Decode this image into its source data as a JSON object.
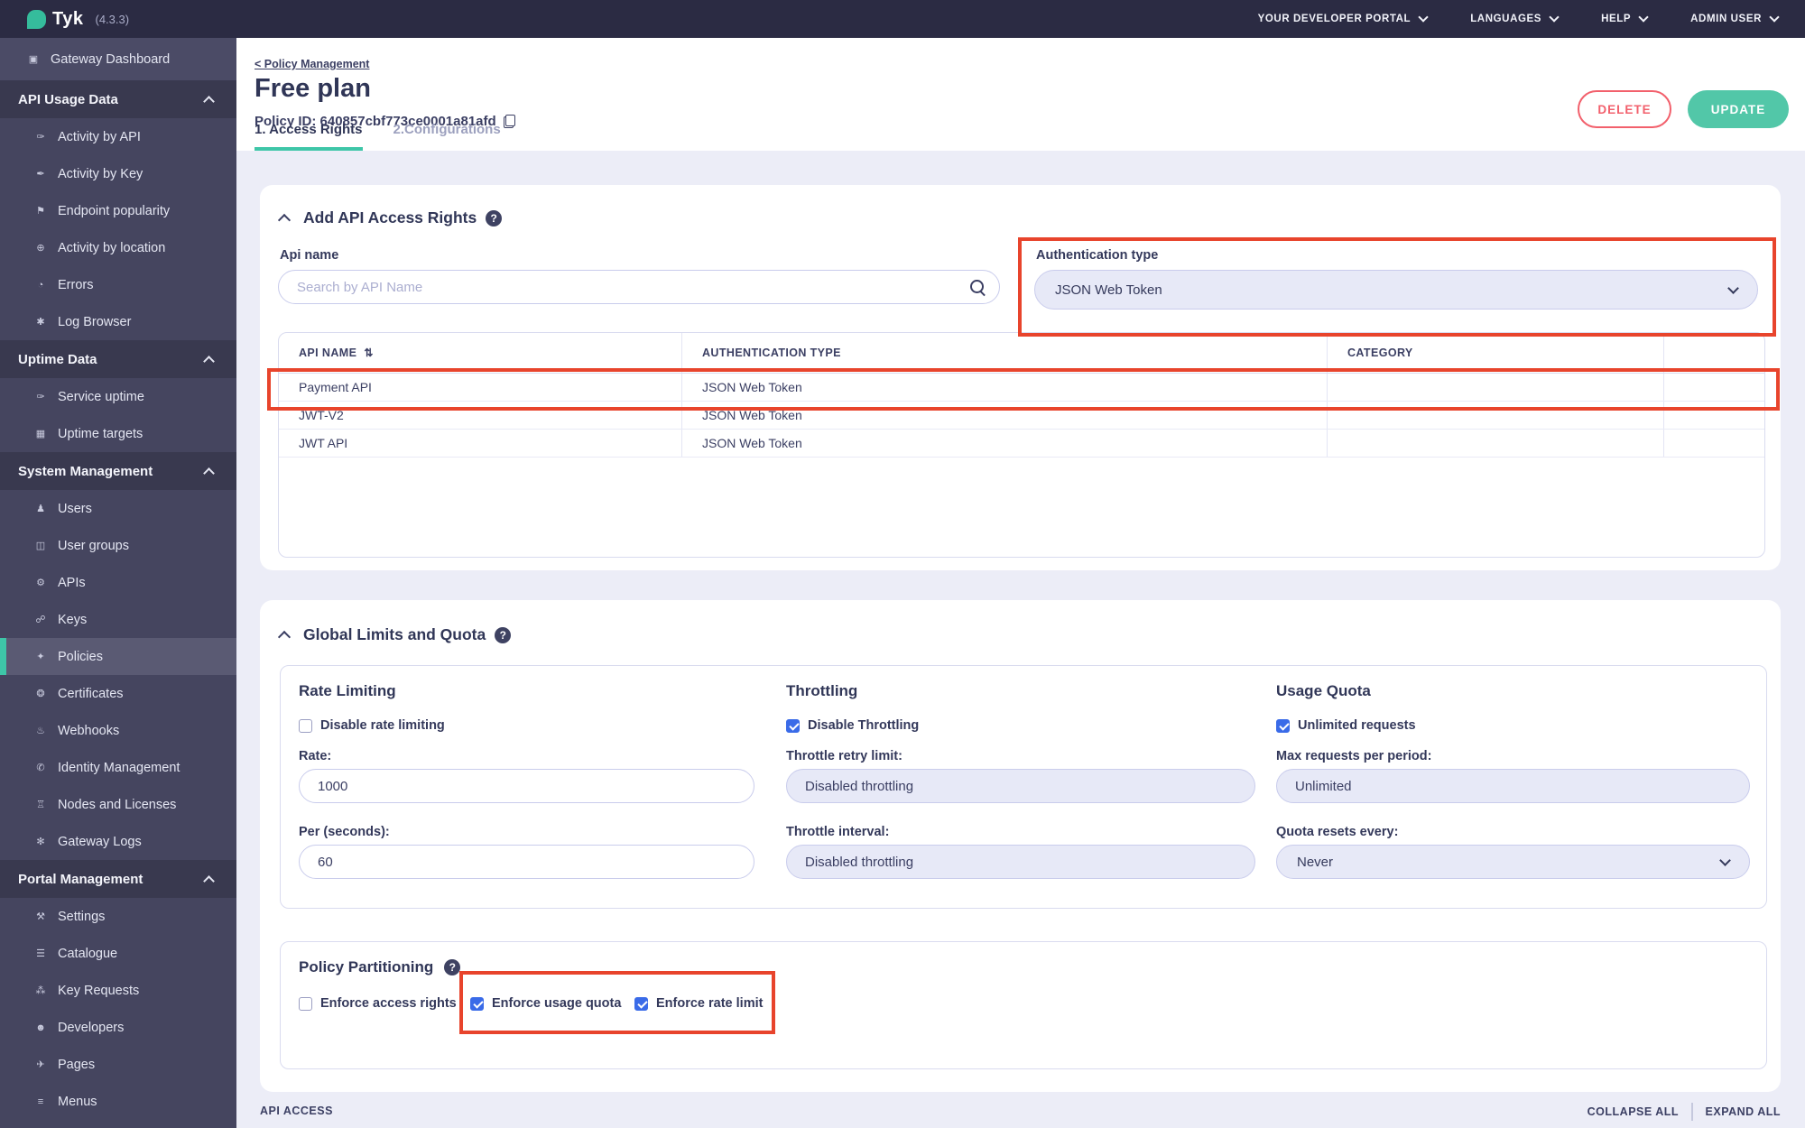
{
  "topbar": {
    "logo_text": "Tyk",
    "version": "(4.3.3)",
    "menu": [
      {
        "label": "YOUR DEVELOPER PORTAL"
      },
      {
        "label": "LANGUAGES"
      },
      {
        "label": "HELP"
      },
      {
        "label": "ADMIN USER"
      }
    ]
  },
  "sidebar": {
    "standalone": {
      "label": "Gateway Dashboard",
      "icon": "monitor-icon",
      "glyph": "▣"
    },
    "sections": [
      {
        "label": "API Usage Data",
        "items": [
          {
            "label": "Activity by API",
            "icon": "activity-api-icon",
            "glyph": "✑"
          },
          {
            "label": "Activity by Key",
            "icon": "key-icon",
            "glyph": "✒"
          },
          {
            "label": "Endpoint popularity",
            "icon": "flag-icon",
            "glyph": "⚑"
          },
          {
            "label": "Activity by location",
            "icon": "globe-icon",
            "glyph": "⊕"
          },
          {
            "label": "Errors",
            "icon": "error-icon",
            "glyph": "◔"
          },
          {
            "label": "Log Browser",
            "icon": "bug-icon",
            "glyph": "✱"
          }
        ]
      },
      {
        "label": "Uptime Data",
        "items": [
          {
            "label": "Service uptime",
            "icon": "uptime-icon",
            "glyph": "✑"
          },
          {
            "label": "Uptime targets",
            "icon": "targets-icon",
            "glyph": "▦"
          }
        ]
      },
      {
        "label": "System Management",
        "items": [
          {
            "label": "Users",
            "icon": "user-icon",
            "glyph": "♟"
          },
          {
            "label": "User groups",
            "icon": "user-group-icon",
            "glyph": "◫"
          },
          {
            "label": "APIs",
            "icon": "gears-icon",
            "glyph": "⚙"
          },
          {
            "label": "Keys",
            "icon": "keys-icon",
            "glyph": "☍"
          },
          {
            "label": "Policies",
            "icon": "policies-icon",
            "glyph": "✦",
            "active": true
          },
          {
            "label": "Certificates",
            "icon": "certificate-icon",
            "glyph": "❂"
          },
          {
            "label": "Webhooks",
            "icon": "bell-icon",
            "glyph": "♨"
          },
          {
            "label": "Identity Management",
            "icon": "identity-icon",
            "glyph": "✆"
          },
          {
            "label": "Nodes and Licenses",
            "icon": "bank-icon",
            "glyph": "♖"
          },
          {
            "label": "Gateway Logs",
            "icon": "logs-icon",
            "glyph": "✻"
          }
        ]
      },
      {
        "label": "Portal Management",
        "items": [
          {
            "label": "Settings",
            "icon": "wrench-icon",
            "glyph": "⚒"
          },
          {
            "label": "Catalogue",
            "icon": "catalogue-icon",
            "glyph": "☰"
          },
          {
            "label": "Key Requests",
            "icon": "paw-icon",
            "glyph": "⁂"
          },
          {
            "label": "Developers",
            "icon": "developers-icon",
            "glyph": "☻"
          },
          {
            "label": "Pages",
            "icon": "pages-icon",
            "glyph": "✈"
          },
          {
            "label": "Menus",
            "icon": "menus-icon",
            "glyph": "≡"
          }
        ]
      }
    ]
  },
  "header": {
    "breadcrumb": "< Policy Management",
    "title": "Free plan",
    "policy_id": "Policy ID: 640857cbf773ce0001a81afd",
    "delete_label": "DELETE",
    "update_label": "UPDATE",
    "tabs": [
      {
        "label": "1. Access Rights",
        "active": true
      },
      {
        "label": "2.Configurations",
        "active": false
      }
    ]
  },
  "access_rights": {
    "section_title": "Add API Access Rights",
    "api_name_label": "Api name",
    "search_placeholder": "Search by API Name",
    "auth_type_label": "Authentication type",
    "auth_type_value": "JSON Web Token",
    "table": {
      "columns": [
        "API NAME",
        "AUTHENTICATION TYPE",
        "CATEGORY"
      ],
      "rows": [
        {
          "api_name": "Payment API",
          "auth_type": "JSON Web Token",
          "category": "",
          "highlighted": true
        },
        {
          "api_name": "JWT-V2",
          "auth_type": "JSON Web Token",
          "category": "",
          "highlighted": false
        },
        {
          "api_name": "JWT API",
          "auth_type": "JSON Web Token",
          "category": "",
          "highlighted": false
        }
      ]
    }
  },
  "global_limits": {
    "section_title": "Global Limits and Quota",
    "rate_limiting": {
      "title": "Rate Limiting",
      "checkbox_label": "Disable rate limiting",
      "checkbox_checked": false,
      "rate_label": "Rate:",
      "rate_value": "1000",
      "per_label": "Per (seconds):",
      "per_value": "60"
    },
    "throttling": {
      "title": "Throttling",
      "checkbox_label": "Disable Throttling",
      "checkbox_checked": true,
      "retry_label": "Throttle retry limit:",
      "retry_value": "Disabled throttling",
      "interval_label": "Throttle interval:",
      "interval_value": "Disabled throttling"
    },
    "usage_quota": {
      "title": "Usage Quota",
      "checkbox_label": "Unlimited requests",
      "checkbox_checked": true,
      "max_label": "Max requests per period:",
      "max_value": "Unlimited",
      "resets_label": "Quota resets every:",
      "resets_value": "Never"
    }
  },
  "policy_partitioning": {
    "title": "Policy Partitioning",
    "checkboxes": [
      {
        "label": "Enforce access rights",
        "checked": false
      },
      {
        "label": "Enforce usage quota",
        "checked": true
      },
      {
        "label": "Enforce rate limit",
        "checked": true
      }
    ]
  },
  "footer": {
    "left": "API ACCESS",
    "collapse": "COLLAPSE ALL",
    "expand": "EXPAND ALL"
  },
  "icons": {
    "help_glyph": "?",
    "sort_glyph": "⇅"
  },
  "colors": {
    "accent_teal": "#3EC6A8",
    "delete_coral": "#F2606C",
    "highlight_red": "#E8442C",
    "checkbox_blue": "#3A6BE8",
    "sidebar_bg": "#45455F",
    "topbar_bg": "#2B2B43",
    "page_bg": "#ECEDF7"
  }
}
